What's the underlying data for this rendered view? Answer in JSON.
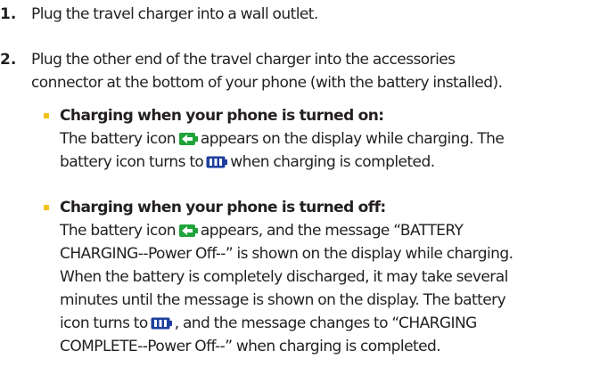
{
  "colors": {
    "text": "#231f20",
    "bullet": "#f2c21b",
    "battery_charging_icon": "#1fa33a",
    "battery_full_icon": "#1d3f9e"
  },
  "steps": [
    {
      "number": "1.",
      "lines": [
        "Plug the travel charger into a wall outlet."
      ]
    },
    {
      "number": "2.",
      "lines": [
        "Plug the other end of the travel charger into the accessories",
        "connector at the bottom of your phone (with the battery installed)."
      ]
    }
  ],
  "bullets": [
    {
      "heading": "Charging when your phone is turned on:",
      "line1_a": "The battery icon",
      "line1_b": "appears on the display while charging. The",
      "line2_a": "battery icon turns to",
      "line2_b": "when charging is completed."
    },
    {
      "heading": "Charging when your phone is turned off:",
      "line1_a": "The battery icon",
      "line1_b": "appears, and the message “BATTERY",
      "line2": "CHARGING--Power Off--” is shown on the display while charging.",
      "line3": "When the battery is completely discharged, it may take several",
      "line4": "minutes until the message is shown on the display. The battery",
      "line5_a": "icon turns to",
      "line5_b": ", and the message changes to “CHARGING",
      "line6": "COMPLETE--Power Off--” when charging is completed."
    }
  ],
  "icons": {
    "charging": "battery-charging-icon",
    "full": "battery-full-icon"
  }
}
